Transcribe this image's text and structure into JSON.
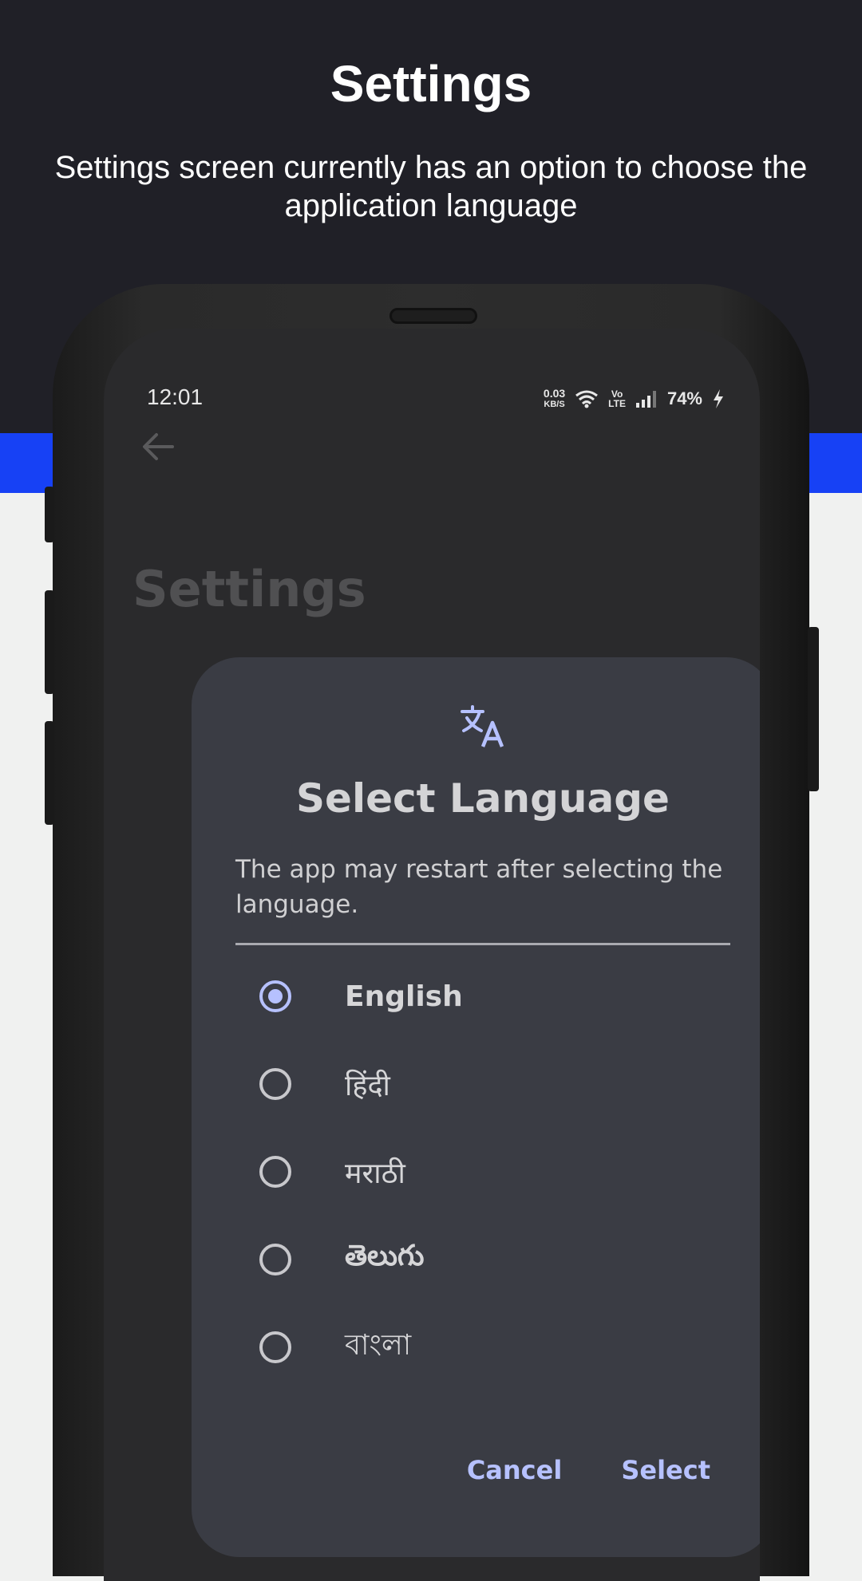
{
  "header": {
    "title": "Settings",
    "subtitle": "Settings screen currently has an option to choose the application language"
  },
  "status_bar": {
    "time": "12:01",
    "net_speed_value": "0.03",
    "net_speed_unit": "KB/S",
    "volte_top": "Vo",
    "volte_bottom": "LTE",
    "battery": "74%"
  },
  "app": {
    "screen_title": "Settings"
  },
  "dialog": {
    "title": "Select Language",
    "body": "The app may restart after selecting the language.",
    "languages": [
      {
        "label": "English",
        "selected": true
      },
      {
        "label": "हिंदी",
        "selected": false
      },
      {
        "label": "मराठी",
        "selected": false
      },
      {
        "label": "తెలుగు",
        "selected": false
      },
      {
        "label": "বাংলা",
        "selected": false
      }
    ],
    "cancel_label": "Cancel",
    "select_label": "Select"
  },
  "colors": {
    "accent": "#b6c1ff",
    "header_bg": "#202027",
    "band_blue": "#1741f5",
    "dialog_bg": "#3a3c44"
  }
}
